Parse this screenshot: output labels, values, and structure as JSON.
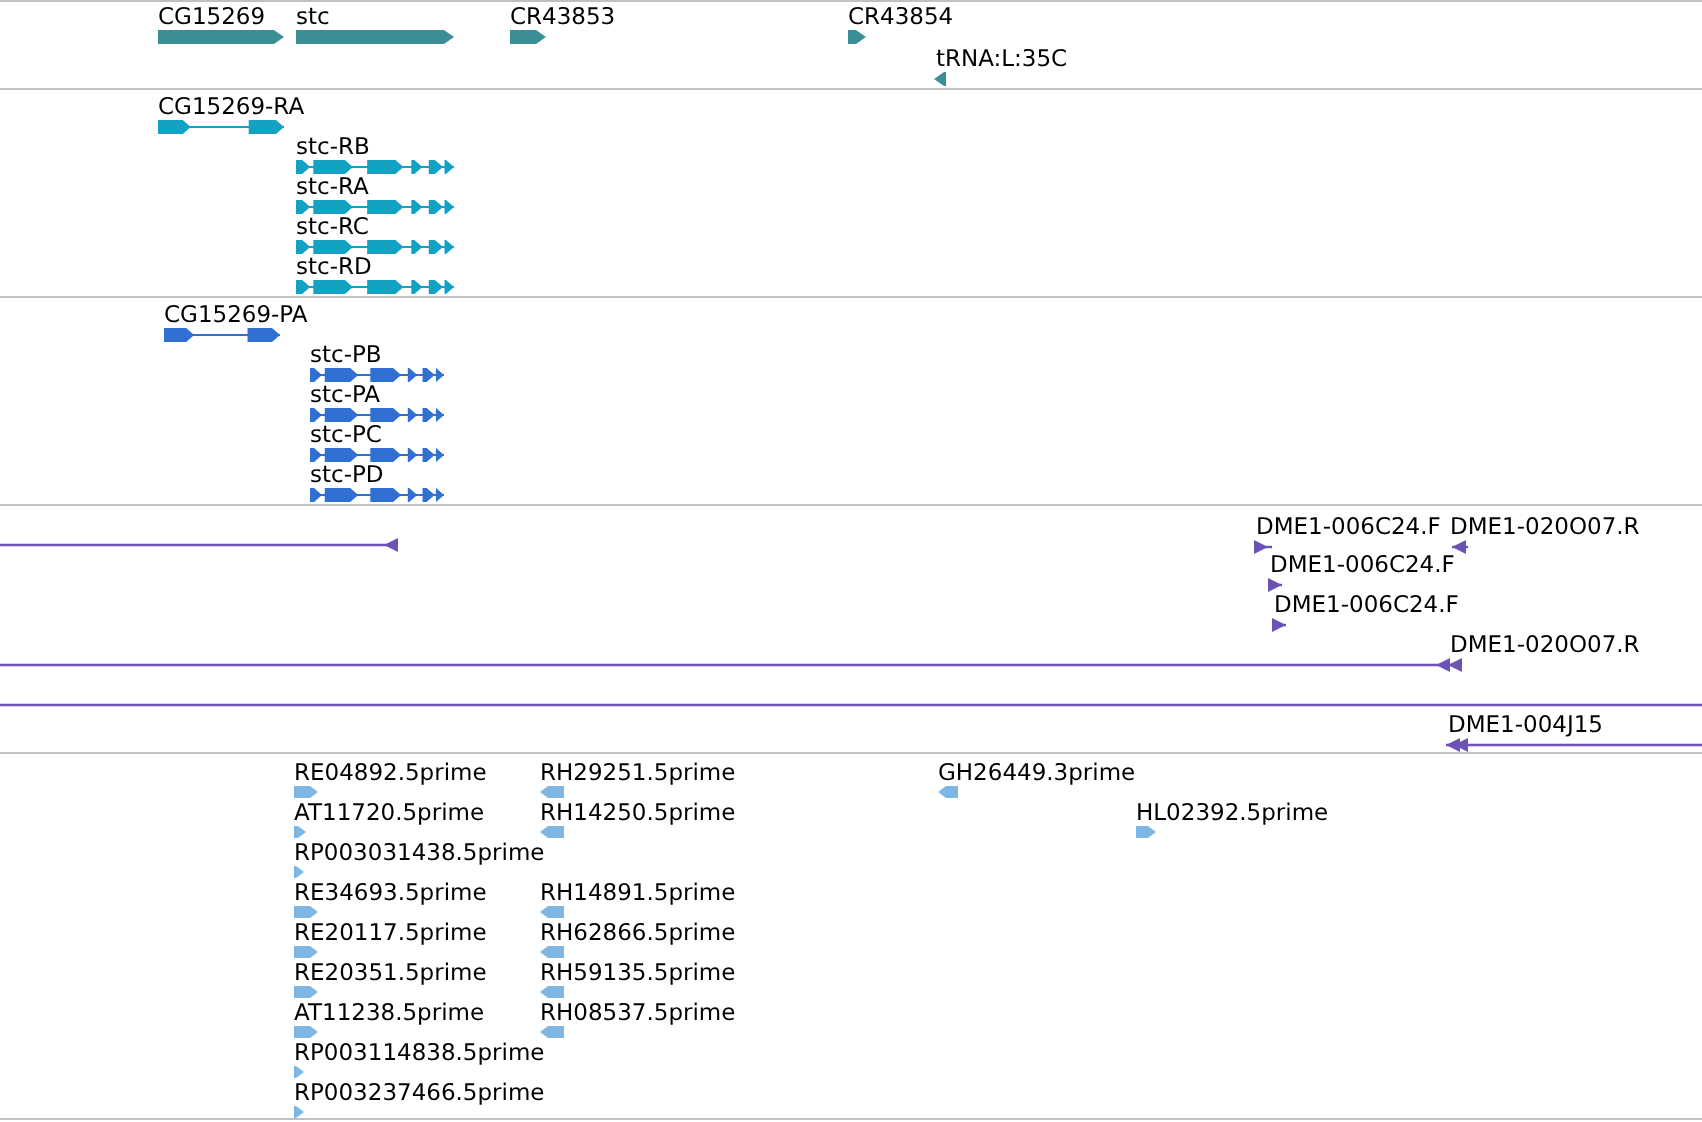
{
  "tracks": [
    {
      "kind": "gene",
      "color": "#3a8e96",
      "features": [
        {
          "label": "CG15269",
          "reverse": false
        },
        {
          "label": "stc",
          "reverse": false
        },
        {
          "label": "CR43853",
          "reverse": false
        },
        {
          "label": "CR43854",
          "reverse": false
        },
        {
          "label": "tRNA:L:35C",
          "reverse": true
        }
      ]
    },
    {
      "kind": "transcript",
      "color": "#13a2c4",
      "features": [
        {
          "label": "CG15269-RA",
          "reverse": false
        },
        {
          "label": "stc-RB",
          "reverse": false
        },
        {
          "label": "stc-RA",
          "reverse": false
        },
        {
          "label": "stc-RC",
          "reverse": false
        },
        {
          "label": "stc-RD",
          "reverse": false
        }
      ]
    },
    {
      "kind": "transcript",
      "color": "#3170d2",
      "features": [
        {
          "label": "CG15269-PA",
          "reverse": false
        },
        {
          "label": "stc-PB",
          "reverse": false
        },
        {
          "label": "stc-PA",
          "reverse": false
        },
        {
          "label": "stc-PC",
          "reverse": false
        },
        {
          "label": "stc-PD",
          "reverse": false
        }
      ]
    },
    {
      "kind": "clone",
      "color": "#6b52b4",
      "features": [
        {
          "kind": "clone",
          "label": "DME1-006C24.F",
          "reverse": false
        },
        {
          "kind": "clone",
          "label": "DME1-020O07.R",
          "reverse": true
        },
        {
          "kind": "clone",
          "reverse": true
        },
        {
          "kind": "clone",
          "label": "DME1-006C24.F",
          "reverse": false
        },
        {
          "kind": "clone",
          "label": "DME1-006C24.F",
          "reverse": false
        },
        {
          "kind": "clone",
          "label": "DME1-020O07.R",
          "reverse": true
        },
        {
          "kind": "line"
        },
        {
          "kind": "clone",
          "label": "DME1-004J15",
          "reverse": true
        }
      ]
    },
    {
      "kind": "est",
      "color": "#7db6e2",
      "features": [
        {
          "label": "RE04892.5prime",
          "reverse": false
        },
        {
          "label": "RH29251.5prime",
          "reverse": true
        },
        {
          "label": "GH26449.3prime",
          "reverse": true
        },
        {
          "label": "AT11720.5prime",
          "reverse": false
        },
        {
          "label": "RH14250.5prime",
          "reverse": true
        },
        {
          "label": "HL02392.5prime",
          "reverse": false
        },
        {
          "label": "RP003031438.5prime",
          "reverse": false
        },
        {
          "label": "RE34693.5prime",
          "reverse": false
        },
        {
          "label": "RH14891.5prime",
          "reverse": true
        },
        {
          "label": "RE20117.5prime",
          "reverse": false
        },
        {
          "label": "RH62866.5prime",
          "reverse": true
        },
        {
          "label": "RE20351.5prime",
          "reverse": false
        },
        {
          "label": "RH59135.5prime",
          "reverse": true
        },
        {
          "label": "AT11238.5prime",
          "reverse": false
        },
        {
          "label": "RH08537.5prime",
          "reverse": true
        },
        {
          "label": "RP003114838.5prime",
          "reverse": false
        },
        {
          "label": "RP003237466.5prime",
          "reverse": false
        }
      ]
    }
  ]
}
